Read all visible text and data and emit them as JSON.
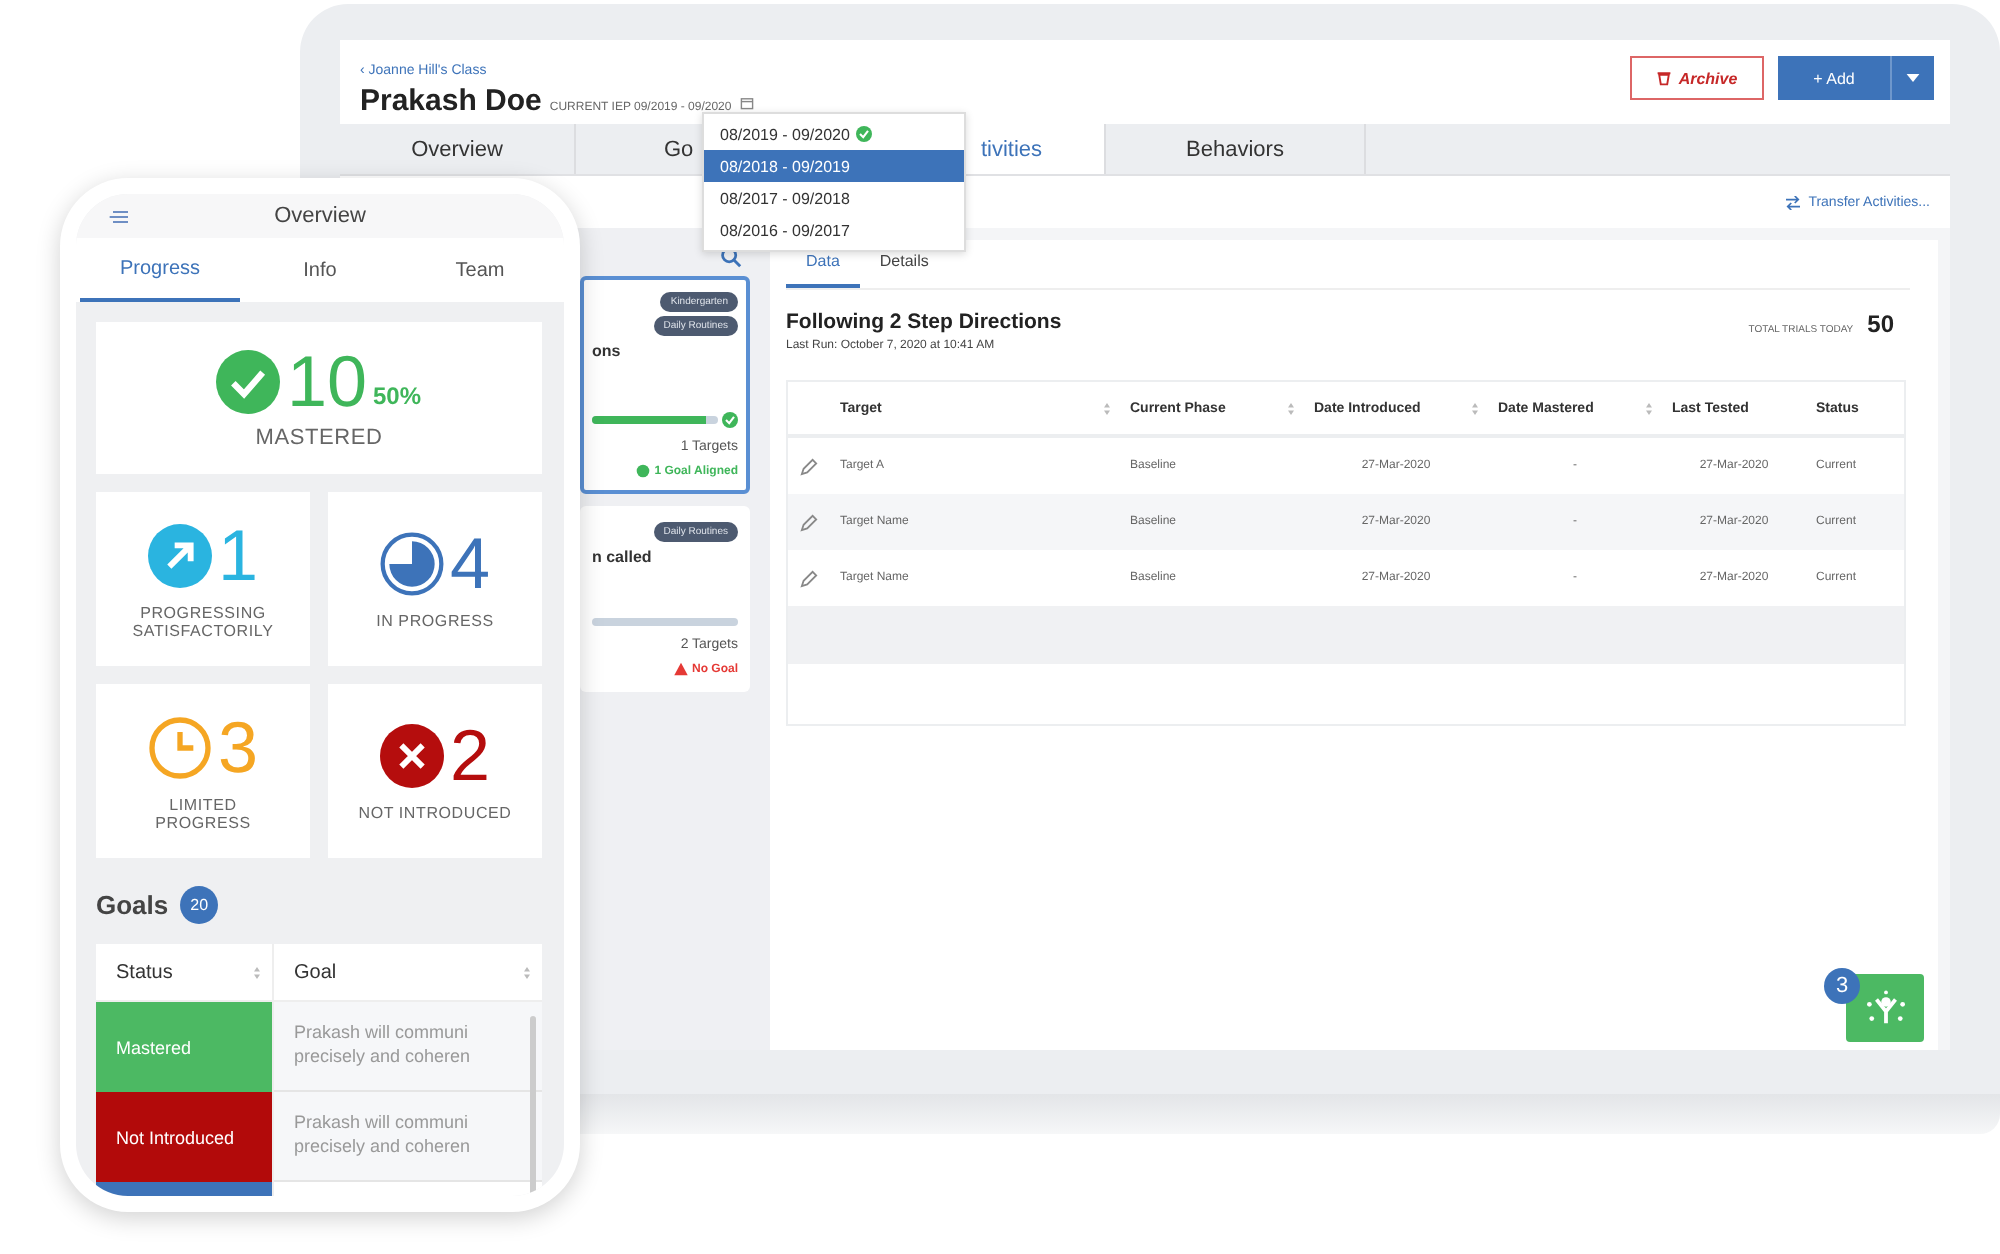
{
  "laptop": {
    "breadcrumb": "‹ Joanne Hill's Class",
    "student_name": "Prakash Doe",
    "iep_label": "CURRENT IEP 09/2019 - 09/2020",
    "archive_button": "Archive",
    "add_button": "+ Add",
    "tabs": [
      {
        "label": "Overview",
        "selected": false
      },
      {
        "label": "Go",
        "selected": false
      },
      {
        "label": "tivities",
        "selected": true
      },
      {
        "label": "Behaviors",
        "selected": false
      }
    ],
    "iep_dropdown": [
      {
        "label": "08/2019 - 09/2020",
        "selected": false,
        "current": true
      },
      {
        "label": "08/2018 - 09/2019",
        "selected": true,
        "current": false
      },
      {
        "label": "08/2017 - 09/2018",
        "selected": false,
        "current": false
      },
      {
        "label": "08/2016 - 09/2017",
        "selected": false,
        "current": false
      }
    ],
    "transfer_link": "Transfer Activities...",
    "activity_cards": [
      {
        "tags": [
          "Kindergarten",
          "Daily Routines"
        ],
        "title": "ons",
        "selected": true,
        "level": 0.9,
        "targets": "1 Targets",
        "goal": {
          "kind": "aligned",
          "text": "1 Goal Aligned"
        }
      },
      {
        "tags": [
          "Daily Routines"
        ],
        "title": "n called",
        "selected": false,
        "level": 0,
        "targets": "2 Targets",
        "goal": {
          "kind": "missing",
          "text": "No Goal"
        }
      }
    ],
    "detail": {
      "tabs": [
        {
          "label": "Data",
          "selected": true
        },
        {
          "label": "Details",
          "selected": false
        }
      ],
      "title": "Following 2 Step Directions",
      "last_run": "Last Run: October 7, 2020 at 10:41 AM",
      "total_label": "TOTAL TRIALS TODAY",
      "total_value": "50",
      "columns": [
        {
          "label": "Target",
          "sortable": true
        },
        {
          "label": "Current Phase",
          "sortable": true
        },
        {
          "label": "Date Introduced",
          "sortable": true
        },
        {
          "label": "Date Mastered",
          "sortable": true
        },
        {
          "label": "Last Tested",
          "sortable": false
        },
        {
          "label": "Status",
          "sortable": false
        }
      ],
      "rows": [
        [
          "Target A",
          "Baseline",
          "27-Mar-2020",
          "-",
          "27-Mar-2020",
          "Current"
        ],
        [
          "Target Name",
          "Baseline",
          "27-Mar-2020",
          "-",
          "27-Mar-2020",
          "Current"
        ],
        [
          "Target Name",
          "Baseline",
          "27-Mar-2020",
          "-",
          "27-Mar-2020",
          "Current"
        ]
      ]
    },
    "fab_badge": "3"
  },
  "phone": {
    "title": "Overview",
    "tabs": [
      {
        "label": "Progress",
        "selected": true
      },
      {
        "label": "Info",
        "selected": false
      },
      {
        "label": "Team",
        "selected": false
      }
    ],
    "stats": [
      {
        "kind": "mastered",
        "count": "10",
        "percent": "50%",
        "label": "MASTERED"
      },
      {
        "kind": "progressing",
        "count": "1",
        "label": "PROGRESSING SATISFACTORILY"
      },
      {
        "kind": "in_progress",
        "count": "4",
        "label": "IN PROGRESS"
      },
      {
        "kind": "limited",
        "count": "3",
        "label": "LIMITED PROGRESS"
      },
      {
        "kind": "not_introduced",
        "count": "2",
        "label": "NOT INTRODUCED"
      }
    ],
    "goals_title": "Goals",
    "goals_count": "20",
    "goal_columns": [
      "Status",
      "Goal"
    ],
    "goals": [
      {
        "kind": "mastered",
        "status": "Mastered",
        "goal": "Prakash will communi\nprecisely and coheren"
      },
      {
        "kind": "not_introduced",
        "status": "Not Introduced",
        "goal": "Prakash will communi\nprecisely and coheren"
      },
      {
        "kind": "in_progress"
      }
    ]
  }
}
